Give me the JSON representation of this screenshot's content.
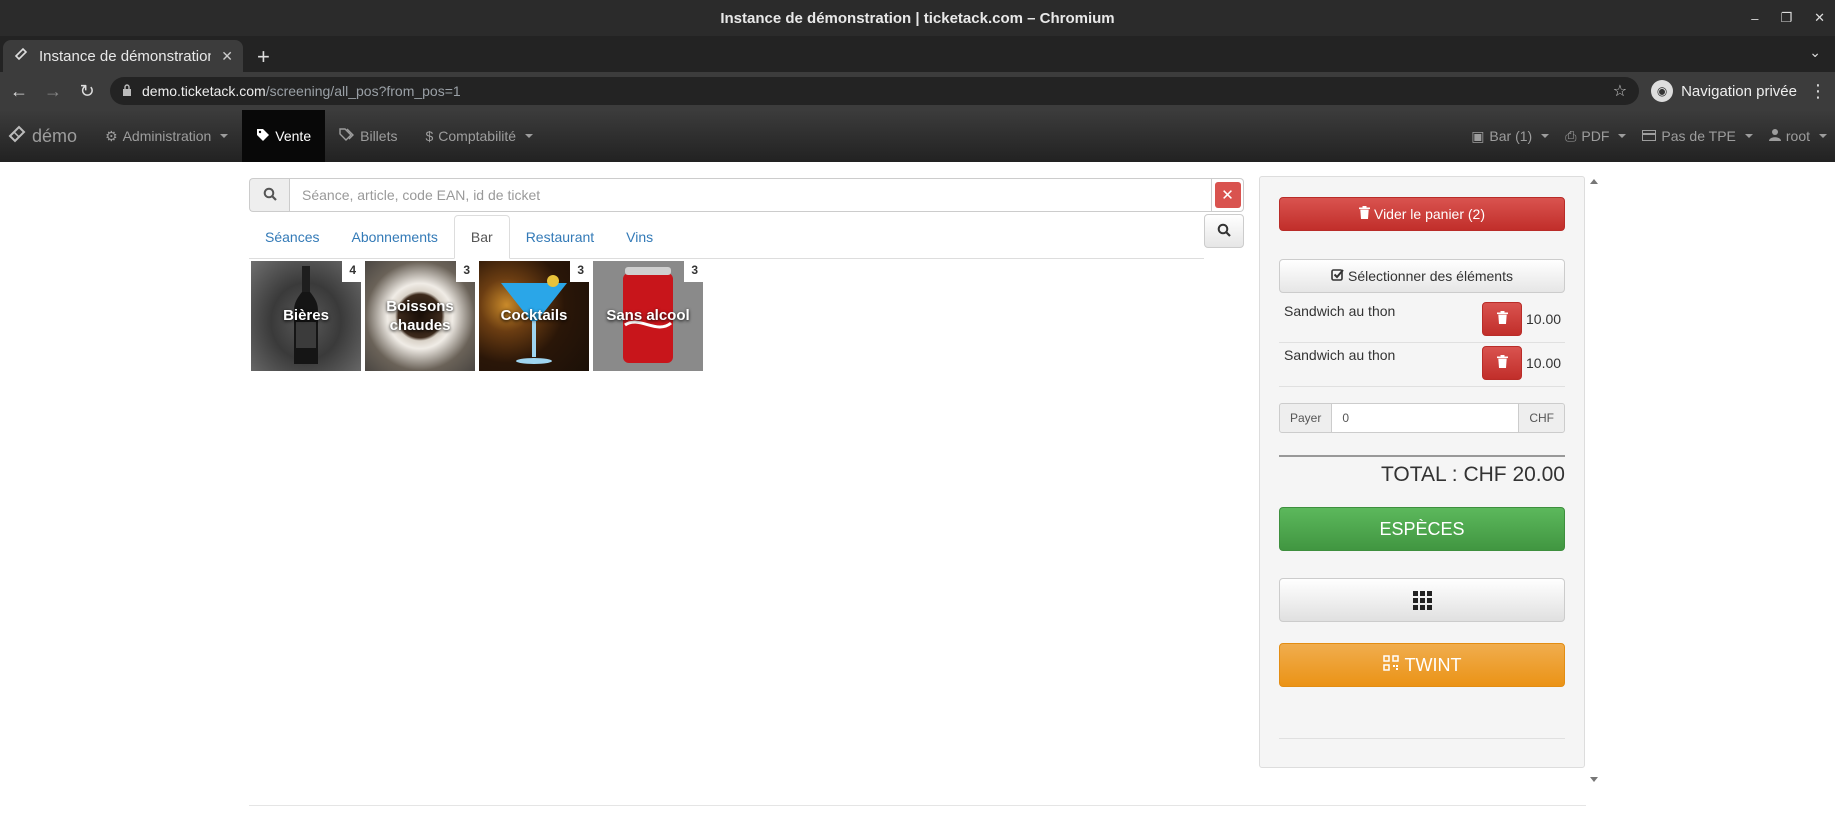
{
  "browser": {
    "window_title": "Instance de démonstration | ticketack.com – Chromium",
    "tab_title": "Instance de démonstration | ticketack.com",
    "tab_close": "✕",
    "url_host": "demo.ticketack.com",
    "url_path": "/screening/all_pos?from_pos=1",
    "private_label": "Navigation privée"
  },
  "navbar": {
    "brand": "démo",
    "items": [
      {
        "label": "Administration",
        "icon": "gear-icon",
        "dropdown": true
      },
      {
        "label": "Vente",
        "icon": "tag-icon",
        "active": true
      },
      {
        "label": "Billets",
        "icon": "tags-icon"
      },
      {
        "label": "Comptabilité",
        "icon": "dollar-icon",
        "dropdown": true
      }
    ],
    "right": [
      {
        "label": "Bar (1)",
        "icon": "inbox-icon"
      },
      {
        "label": "PDF",
        "icon": "print-icon"
      },
      {
        "label": "Pas de TPE",
        "icon": "credit-card-icon"
      },
      {
        "label": "root",
        "icon": "user-icon"
      }
    ]
  },
  "search": {
    "placeholder": "Séance, article, code EAN, id de ticket"
  },
  "tabs": [
    {
      "label": "Séances"
    },
    {
      "label": "Abonnements"
    },
    {
      "label": "Bar",
      "active": true
    },
    {
      "label": "Restaurant"
    },
    {
      "label": "Vins"
    }
  ],
  "tiles": [
    {
      "label": "Bières",
      "count": "4"
    },
    {
      "label": "Boissons chaudes",
      "count": "3"
    },
    {
      "label": "Cocktails",
      "count": "3"
    },
    {
      "label": "Sans alcool",
      "count": "3"
    }
  ],
  "cart": {
    "empty_label": "Vider le panier (2)",
    "select_label": "Sélectionner des éléments",
    "items": [
      {
        "name": "Sandwich au thon",
        "price": "10.00"
      },
      {
        "name": "Sandwich au thon",
        "price": "10.00"
      }
    ],
    "pay_label": "Payer",
    "pay_value": "0",
    "pay_currency": "CHF",
    "total": "TOTAL : CHF 20.00",
    "cash_label": "ESPÈCES",
    "twint_label": "TWINT"
  },
  "colors": {
    "danger": "#d9534f",
    "success": "#5cb85c",
    "warning": "#f0ad4e",
    "link": "#337ab7"
  }
}
